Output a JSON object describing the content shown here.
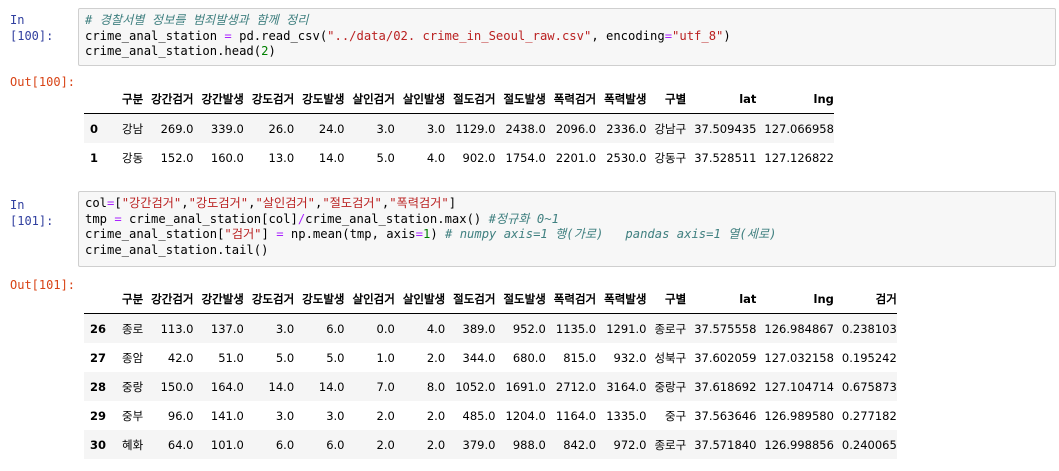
{
  "cells": [
    {
      "in_prompt": "In [100]:",
      "code": [
        [
          [
            "comment",
            "# 경찰서별 정보를 범죄발생과 함께 정리"
          ]
        ],
        [
          [
            "plain",
            "crime_anal_station "
          ],
          [
            "op",
            "="
          ],
          [
            "plain",
            " pd.read_csv("
          ],
          [
            "str",
            "\"../data/02. crime_in_Seoul_raw.csv\""
          ],
          [
            "plain",
            ", encoding"
          ],
          [
            "op",
            "="
          ],
          [
            "str",
            "\"utf_8\""
          ],
          [
            "plain",
            ")"
          ]
        ],
        [
          [
            "plain",
            "crime_anal_station.head("
          ],
          [
            "num",
            "2"
          ],
          [
            "plain",
            ")"
          ]
        ]
      ],
      "out_prompt": "Out[100]:",
      "table": {
        "columns": [
          "구분",
          "강간검거",
          "강간발생",
          "강도검거",
          "강도발생",
          "살인검거",
          "살인발생",
          "절도검거",
          "절도발생",
          "폭력검거",
          "폭력발생",
          "구별",
          "lat",
          "lng"
        ],
        "rows": [
          {
            "index": "0",
            "cells": [
              "강남",
              "269.0",
              "339.0",
              "26.0",
              "24.0",
              "3.0",
              "3.0",
              "1129.0",
              "2438.0",
              "2096.0",
              "2336.0",
              "강남구",
              "37.509435",
              "127.066958"
            ]
          },
          {
            "index": "1",
            "cells": [
              "강동",
              "152.0",
              "160.0",
              "13.0",
              "14.0",
              "5.0",
              "4.0",
              "902.0",
              "1754.0",
              "2201.0",
              "2530.0",
              "강동구",
              "37.528511",
              "127.126822"
            ]
          }
        ]
      }
    },
    {
      "in_prompt": "In [101]:",
      "code": [
        [
          [
            "plain",
            "col"
          ],
          [
            "op",
            "="
          ],
          [
            "plain",
            "["
          ],
          [
            "str",
            "\"강간검거\""
          ],
          [
            "plain",
            ","
          ],
          [
            "str",
            "\"강도검거\""
          ],
          [
            "plain",
            ","
          ],
          [
            "str",
            "\"살인검거\""
          ],
          [
            "plain",
            ","
          ],
          [
            "str",
            "\"절도검거\""
          ],
          [
            "plain",
            ","
          ],
          [
            "str",
            "\"폭력검거\""
          ],
          [
            "plain",
            "]"
          ]
        ],
        [
          [
            "plain",
            "tmp "
          ],
          [
            "op",
            "="
          ],
          [
            "plain",
            " crime_anal_station[col]"
          ],
          [
            "op",
            "/"
          ],
          [
            "plain",
            "crime_anal_station.max() "
          ],
          [
            "comment",
            "#정규화 0~1"
          ]
        ],
        [
          [
            "plain",
            "crime_anal_station["
          ],
          [
            "str",
            "\"검거\""
          ],
          [
            "plain",
            "] "
          ],
          [
            "op",
            "="
          ],
          [
            "plain",
            " np.mean(tmp, axis"
          ],
          [
            "op",
            "="
          ],
          [
            "num",
            "1"
          ],
          [
            "plain",
            ") "
          ],
          [
            "comment",
            "# numpy axis=1 행(가로)   pandas axis=1 열(세로)"
          ]
        ],
        [
          [
            "plain",
            "crime_anal_station.tail()"
          ]
        ]
      ],
      "out_prompt": "Out[101]:",
      "table": {
        "columns": [
          "구분",
          "강간검거",
          "강간발생",
          "강도검거",
          "강도발생",
          "살인검거",
          "살인발생",
          "절도검거",
          "절도발생",
          "폭력검거",
          "폭력발생",
          "구별",
          "lat",
          "lng",
          "검거"
        ],
        "rows": [
          {
            "index": "26",
            "cells": [
              "종로",
              "113.0",
              "137.0",
              "3.0",
              "6.0",
              "0.0",
              "4.0",
              "389.0",
              "952.0",
              "1135.0",
              "1291.0",
              "종로구",
              "37.575558",
              "126.984867",
              "0.238103"
            ]
          },
          {
            "index": "27",
            "cells": [
              "종암",
              "42.0",
              "51.0",
              "5.0",
              "5.0",
              "1.0",
              "2.0",
              "344.0",
              "680.0",
              "815.0",
              "932.0",
              "성북구",
              "37.602059",
              "127.032158",
              "0.195242"
            ]
          },
          {
            "index": "28",
            "cells": [
              "중랑",
              "150.0",
              "164.0",
              "14.0",
              "14.0",
              "7.0",
              "8.0",
              "1052.0",
              "1691.0",
              "2712.0",
              "3164.0",
              "중랑구",
              "37.618692",
              "127.104714",
              "0.675873"
            ]
          },
          {
            "index": "29",
            "cells": [
              "중부",
              "96.0",
              "141.0",
              "3.0",
              "3.0",
              "2.0",
              "2.0",
              "485.0",
              "1204.0",
              "1164.0",
              "1335.0",
              "중구",
              "37.563646",
              "126.989580",
              "0.277182"
            ]
          },
          {
            "index": "30",
            "cells": [
              "혜화",
              "64.0",
              "101.0",
              "6.0",
              "6.0",
              "2.0",
              "2.0",
              "379.0",
              "988.0",
              "842.0",
              "972.0",
              "종로구",
              "37.571840",
              "126.998856",
              "0.240065"
            ]
          }
        ]
      }
    }
  ]
}
